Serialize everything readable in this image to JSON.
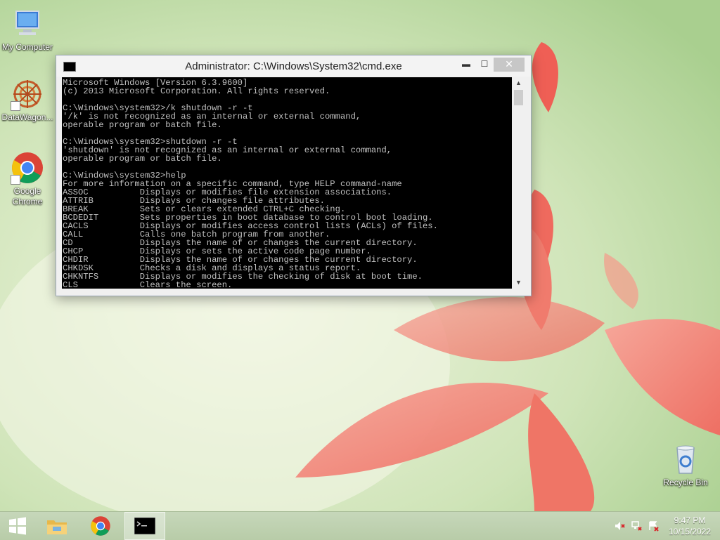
{
  "desktop": {
    "icons": [
      {
        "label": "My Computer",
        "icon": "computer-icon"
      },
      {
        "label": "DataWagon...",
        "icon": "datawagon-icon"
      },
      {
        "label": "Google Chrome",
        "icon": "chrome-icon"
      },
      {
        "label": "Recycle Bin",
        "icon": "recycle-bin-icon"
      }
    ]
  },
  "cmd_window": {
    "title": "Administrator: C:\\Windows\\System32\\cmd.exe",
    "minimize_label": "▬",
    "maximize_label": "☐",
    "close_label": "✕",
    "console_lines": [
      "Microsoft Windows [Version 6.3.9600]",
      "(c) 2013 Microsoft Corporation. All rights reserved.",
      "",
      "C:\\Windows\\system32>/k shutdown -r -t",
      "'/k' is not recognized as an internal or external command,",
      "operable program or batch file.",
      "",
      "C:\\Windows\\system32>shutdown -r -t",
      "'shutdown' is not recognized as an internal or external command,",
      "operable program or batch file.",
      "",
      "C:\\Windows\\system32>help",
      "For more information on a specific command, type HELP command-name",
      "ASSOC          Displays or modifies file extension associations.",
      "ATTRIB         Displays or changes file attributes.",
      "BREAK          Sets or clears extended CTRL+C checking.",
      "BCDEDIT        Sets properties in boot database to control boot loading.",
      "CACLS          Displays or modifies access control lists (ACLs) of files.",
      "CALL           Calls one batch program from another.",
      "CD             Displays the name of or changes the current directory.",
      "CHCP           Displays or sets the active code page number.",
      "CHDIR          Displays the name of or changes the current directory.",
      "CHKDSK         Checks a disk and displays a status report.",
      "CHKNTFS        Displays or modifies the checking of disk at boot time.",
      "CLS            Clears the screen."
    ]
  },
  "taskbar": {
    "start": "start-icon",
    "pinned": [
      "file-explorer-icon",
      "chrome-icon",
      "cmd-icon"
    ],
    "tray": [
      "volume-muted-icon",
      "network-icon",
      "action-center-icon"
    ],
    "time": "9:47 PM",
    "date": "10/15/2022"
  }
}
